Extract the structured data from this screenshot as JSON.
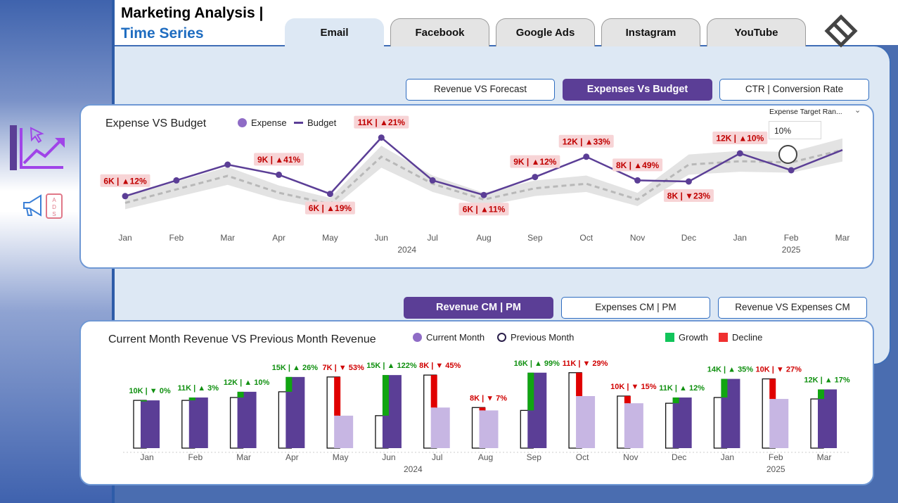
{
  "header": {
    "title_line1": "Marketing Analysis |",
    "title_line2": "Time Series"
  },
  "tabs": [
    {
      "label": "Email",
      "active": true
    },
    {
      "label": "Facebook",
      "active": false
    },
    {
      "label": "Google Ads",
      "active": false
    },
    {
      "label": "Instagram",
      "active": false
    },
    {
      "label": "YouTube",
      "active": false
    }
  ],
  "top_view_buttons": [
    {
      "label": "Revenue VS Forecast",
      "active": false
    },
    {
      "label": "Expenses Vs Budget",
      "active": true
    },
    {
      "label": "CTR | Conversion Rate",
      "active": false
    }
  ],
  "bottom_view_buttons": [
    {
      "label": "Revenue CM | PM",
      "active": true
    },
    {
      "label": "Expenses CM | PM",
      "active": false
    },
    {
      "label": "Revenue VS Expenses CM",
      "active": false
    }
  ],
  "sidebar": {
    "icons": [
      "trend-analysis-icon",
      "ads-megaphone-icon"
    ]
  },
  "slicer": {
    "title": "Expense Target Ran...",
    "value": "10%",
    "slider_position": 0.1
  },
  "colors": {
    "accent_purple": "#5b3e96",
    "budget_line": "#5b3e96",
    "expense_marker": "#5b3e96",
    "badge_bg": "#f7d4d6",
    "badge_text": "#c00000",
    "growth": "#11a511",
    "decline": "#e00000",
    "previous_month_bar": "#c7b6e3",
    "current_month_bar": "#5b3e96",
    "card_border": "#6f98d4",
    "canvas_bg": "#dde8f4"
  },
  "chart_data": [
    {
      "type": "line",
      "title": "Expense VS Budget",
      "legend": [
        {
          "name": "Expense",
          "marker": "circle"
        },
        {
          "name": "Budget",
          "marker": "line"
        }
      ],
      "x": [
        "Jan",
        "Feb",
        "Mar",
        "Apr",
        "May",
        "Jun",
        "Jul",
        "Aug",
        "Sep",
        "Oct",
        "Nov",
        "Dec",
        "Jan",
        "Feb",
        "Mar"
      ],
      "x_year_labels": [
        {
          "label": "2024"
        },
        {
          "label": "2025"
        }
      ],
      "series": [
        {
          "name": "Expense",
          "values": [
            6.2,
            7.6,
            9.0,
            8.1,
            6.4,
            11.4,
            7.6,
            6.3,
            7.9,
            9.7,
            7.6,
            7.5,
            10.0,
            8.5,
            10.3
          ]
        },
        {
          "name": "Budget",
          "values": [
            5.6,
            6.8,
            8.0,
            6.5,
            5.5,
            9.7,
            7.3,
            5.9,
            6.9,
            7.3,
            5.9,
            9.0,
            9.3,
            9.2,
            10.3
          ]
        }
      ],
      "budget_band_pct": 10,
      "data_labels": [
        {
          "index": 0,
          "text": "6K | ▲12%"
        },
        {
          "index": 3,
          "text": "9K | ▲41%"
        },
        {
          "index": 4,
          "text": "6K | ▲19%"
        },
        {
          "index": 5,
          "text": "11K | ▲21%"
        },
        {
          "index": 7,
          "text": "6K | ▲11%"
        },
        {
          "index": 8,
          "text": "9K | ▲12%"
        },
        {
          "index": 9,
          "text": "12K | ▲33%"
        },
        {
          "index": 10,
          "text": "8K | ▲49%"
        },
        {
          "index": 11,
          "text": "8K | ▼23%"
        },
        {
          "index": 12,
          "text": "12K | ▲10%"
        }
      ],
      "ylim": [
        3,
        13
      ]
    },
    {
      "type": "bar",
      "title": "Current Month Revenue VS Previous Month Revenue",
      "legend": [
        {
          "name": "Current Month",
          "marker": "filled-circle"
        },
        {
          "name": "Previous Month",
          "marker": "hollow-circle"
        },
        {
          "name": "Growth",
          "marker": "green-square"
        },
        {
          "name": "Decline",
          "marker": "red-square"
        }
      ],
      "categories": [
        "Jan",
        "Feb",
        "Mar",
        "Apr",
        "May",
        "Jun",
        "Jul",
        "Aug",
        "Sep",
        "Oct",
        "Nov",
        "Dec",
        "Jan",
        "Feb",
        "Mar"
      ],
      "x_year_labels": [
        {
          "label": "2024"
        },
        {
          "label": "2025"
        }
      ],
      "series": [
        {
          "name": "Current Month",
          "values": [
            10.0,
            10.6,
            11.8,
            14.9,
            6.8,
            15.3,
            8.5,
            7.9,
            15.8,
            10.9,
            9.4,
            10.6,
            14.5,
            10.3,
            12.3
          ]
        },
        {
          "name": "Previous Month",
          "values": [
            10.0,
            10.0,
            10.6,
            11.8,
            14.9,
            6.8,
            15.3,
            8.5,
            7.9,
            15.8,
            10.9,
            9.4,
            10.6,
            14.5,
            10.3
          ]
        }
      ],
      "data_labels": [
        "10K | ▼ 0%",
        "11K | ▲ 3%",
        "12K | ▲ 10%",
        "15K | ▲ 26%",
        "7K | ▼ 53%",
        "15K | ▲ 122%",
        "8K | ▼ 45%",
        "8K | ▼ 7%",
        "16K | ▲ 99%",
        "11K | ▼ 29%",
        "10K | ▼ 15%",
        "11K | ▲ 12%",
        "14K | ▲ 35%",
        "10K | ▼ 27%",
        "12K | ▲ 17%"
      ],
      "ylim": [
        0,
        16.5
      ]
    }
  ]
}
